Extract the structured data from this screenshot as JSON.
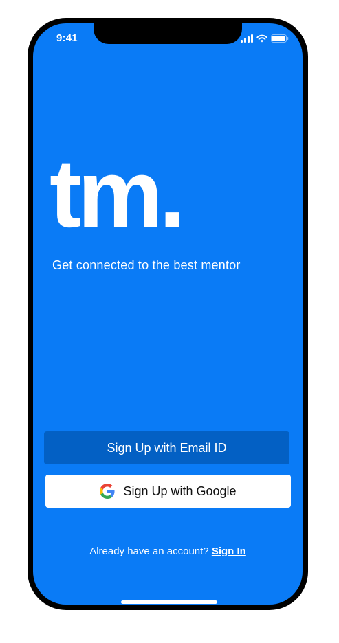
{
  "status_bar": {
    "time": "9:41",
    "icons": [
      "cellular-signal-icon",
      "wifi-icon",
      "battery-icon"
    ]
  },
  "brand": {
    "logo_text": "tm.",
    "tagline": "Get connected to the best mentor"
  },
  "actions": {
    "email_signup_label": "Sign Up with Email ID",
    "google_signup_label": "Sign Up with Google"
  },
  "footer": {
    "prompt_text": "Already have an account?",
    "signin_label": "Sign In"
  },
  "colors": {
    "background": "#0a7bf6",
    "email_button": "#0360c4",
    "google_button": "#ffffff",
    "text": "#ffffff"
  }
}
